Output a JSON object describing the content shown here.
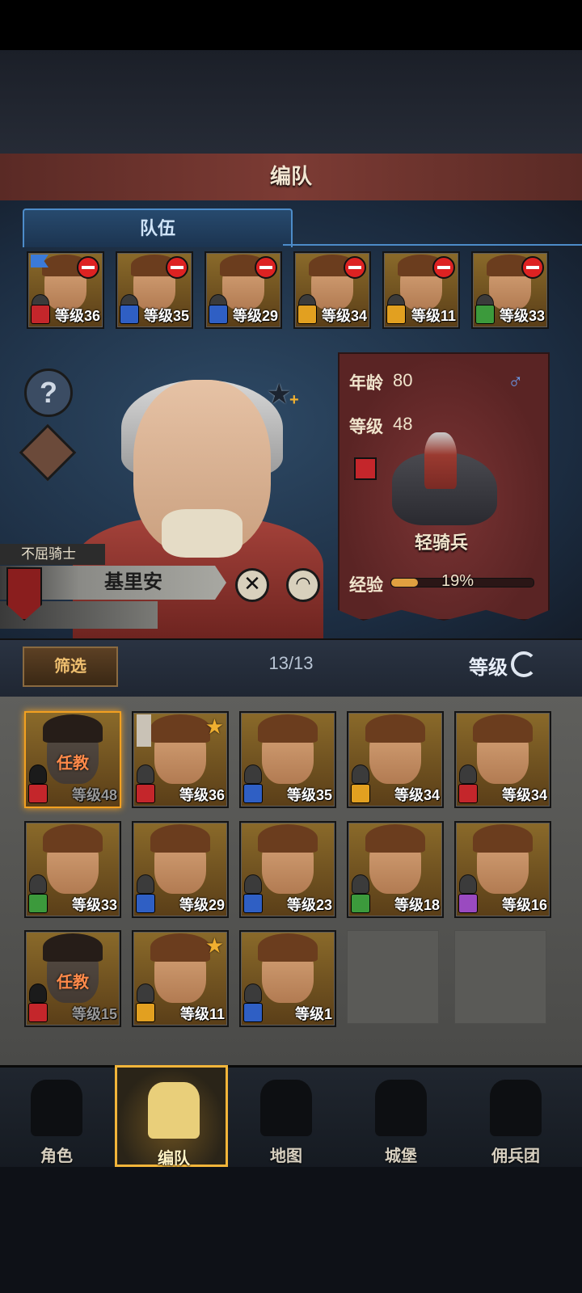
{
  "screen": {
    "title": "编队",
    "tab_label": "队伍"
  },
  "team": [
    {
      "level": "等级36",
      "class_color": "#c4262b",
      "class_icon": "horse-icon",
      "leader": true
    },
    {
      "level": "等级35",
      "class_color": "#2f5fc4",
      "class_icon": "sword-icon"
    },
    {
      "level": "等级29",
      "class_color": "#2f5fc4",
      "class_icon": "sword-icon"
    },
    {
      "level": "等级34",
      "class_color": "#e2a020",
      "class_icon": "shield-icon"
    },
    {
      "level": "等级11",
      "class_color": "#e2a020",
      "class_icon": "shield-icon"
    },
    {
      "level": "等级33",
      "class_color": "#3c9a3c",
      "class_icon": "crossbow-icon"
    }
  ],
  "hero": {
    "title": "不屈骑士",
    "name": "基里安",
    "age_label": "年龄",
    "age": "80",
    "level_label": "等级",
    "level": "48",
    "gender_symbol": "♂",
    "unit_type": "轻骑兵",
    "xp_label": "经验",
    "xp_percent": "19%",
    "xp_fraction": 0.19
  },
  "filter": {
    "button_label": "筛选",
    "count": "13/13",
    "sort_label": "等级"
  },
  "roster": [
    {
      "level": "等级48",
      "class_color": "#c4262b",
      "status": "任教",
      "dim": true,
      "selected": true
    },
    {
      "level": "等级36",
      "class_color": "#c4262b",
      "star": true,
      "flag": true
    },
    {
      "level": "等级35",
      "class_color": "#2f5fc4"
    },
    {
      "level": "等级34",
      "class_color": "#e2a020"
    },
    {
      "level": "等级34",
      "class_color": "#c4262b"
    },
    {
      "level": "等级33",
      "class_color": "#3c9a3c"
    },
    {
      "level": "等级29",
      "class_color": "#2f5fc4"
    },
    {
      "level": "等级23",
      "class_color": "#2f5fc4"
    },
    {
      "level": "等级18",
      "class_color": "#3c9a3c"
    },
    {
      "level": "等级16",
      "class_color": "#9a4ac0"
    },
    {
      "level": "等级15",
      "class_color": "#c4262b",
      "status": "任教",
      "dim": true
    },
    {
      "level": "等级11",
      "class_color": "#e2a020",
      "star": true
    },
    {
      "level": "等级1",
      "class_color": "#2f5fc4"
    }
  ],
  "nav": [
    {
      "label": "角色",
      "icon": "knight-icon"
    },
    {
      "label": "编队",
      "icon": "helmet-icon",
      "active": true
    },
    {
      "label": "地图",
      "icon": "compass-icon"
    },
    {
      "label": "城堡",
      "icon": "castle-icon"
    },
    {
      "label": "佣兵团",
      "icon": "banner-icon"
    }
  ]
}
